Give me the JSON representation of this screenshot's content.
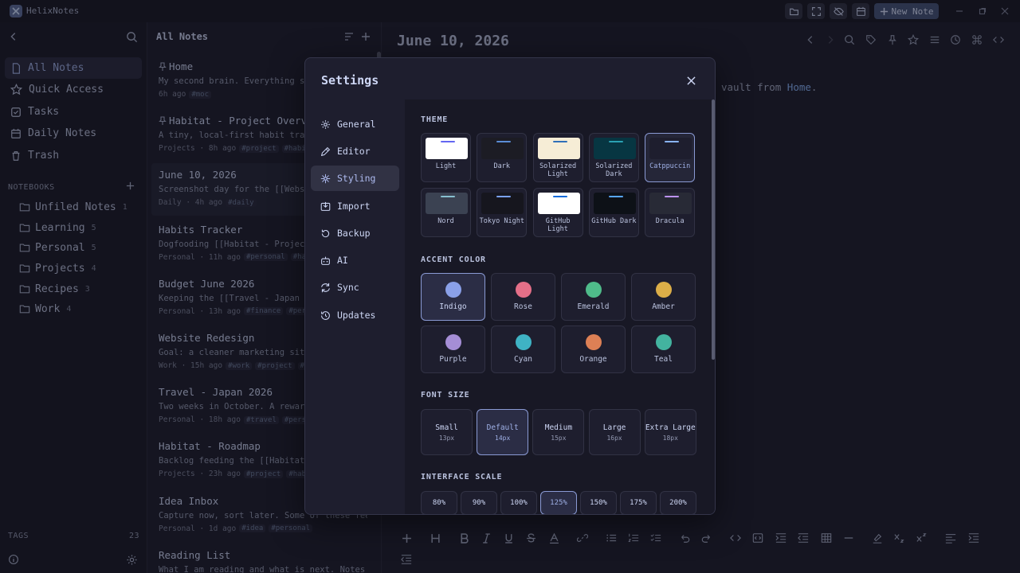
{
  "app": {
    "title": "HelixNotes",
    "new_note_label": "New Note"
  },
  "sidebar": {
    "nav": [
      {
        "label": "All Notes",
        "icon": "file-icon"
      },
      {
        "label": "Quick Access",
        "icon": "star-icon"
      },
      {
        "label": "Tasks",
        "icon": "checkbox-icon"
      },
      {
        "label": "Daily Notes",
        "icon": "calendar-icon"
      },
      {
        "label": "Trash",
        "icon": "trash-icon"
      }
    ],
    "notebooks_label": "NOTEBOOKS",
    "notebooks": [
      {
        "label": "Unfiled Notes",
        "count": "1"
      },
      {
        "label": "Learning",
        "count": "5"
      },
      {
        "label": "Personal",
        "count": "5"
      },
      {
        "label": "Projects",
        "count": "4"
      },
      {
        "label": "Recipes",
        "count": "3"
      },
      {
        "label": "Work",
        "count": "4"
      }
    ],
    "tags_label": "TAGS",
    "tags_count": "23"
  },
  "notes_list": {
    "header": "All Notes",
    "notes": [
      {
        "title": "Home",
        "pinned": true,
        "snippet": "My second brain. Everything sta",
        "meta": "6h ago",
        "tags": [
          "#moc"
        ]
      },
      {
        "title": "Habitat - Project Overvi",
        "pinned": true,
        "snippet": "A tiny, local-first habit track",
        "meta": "Projects · 8h ago",
        "tags": [
          "#project",
          "#habi"
        ]
      },
      {
        "title": "June 10, 2026",
        "pinned": false,
        "snippet": "Screenshot day for the [[Websit",
        "meta": "Daily · 4h ago",
        "tags": [
          "#daily"
        ]
      },
      {
        "title": "Habits Tracker",
        "pinned": false,
        "snippet": "Dogfooding [[Habitat - Project",
        "meta": "Personal · 11h ago",
        "tags": [
          "#personal",
          "#ha"
        ]
      },
      {
        "title": "Budget June 2026",
        "pinned": false,
        "snippet": "Keeping the [[Travel - Japan 20",
        "meta": "Personal · 13h ago",
        "tags": [
          "#finance",
          "#per"
        ]
      },
      {
        "title": "Website Redesign",
        "pinned": false,
        "snippet": "Goal: a cleaner marketing site",
        "meta": "Work · 15h ago",
        "tags": [
          "#work",
          "#project",
          "#"
        ]
      },
      {
        "title": "Travel - Japan 2026",
        "pinned": false,
        "snippet": "Two weeks in October. A reward",
        "meta": "Personal · 18h ago",
        "tags": [
          "#travel",
          "#pers"
        ]
      },
      {
        "title": "Habitat - Roadmap",
        "pinned": false,
        "snippet": "Backlog feeding the [[Habitat -",
        "meta": "Projects · 23h ago",
        "tags": [
          "#project",
          "#hab"
        ]
      },
      {
        "title": "Idea Inbox",
        "pinned": false,
        "snippet": "Capture now, sort later. Some of these feed",
        "meta": "Personal · 1d ago",
        "tags": [
          "#idea",
          "#personal"
        ]
      },
      {
        "title": "Reading List",
        "pinned": false,
        "snippet": "What I am reading and what is next. Notes _",
        "meta": "",
        "tags": []
      }
    ]
  },
  "editor": {
    "title": "June 10, 2026",
    "body_prefix": "vault from ",
    "body_link": "Home",
    "body_suffix": "."
  },
  "settings": {
    "title": "Settings",
    "nav": [
      {
        "label": "General",
        "icon": "gear-icon"
      },
      {
        "label": "Editor",
        "icon": "pencil-icon"
      },
      {
        "label": "Styling",
        "icon": "sparkle-icon"
      },
      {
        "label": "Import",
        "icon": "import-icon"
      },
      {
        "label": "Backup",
        "icon": "backup-icon"
      },
      {
        "label": "AI",
        "icon": "robot-icon"
      },
      {
        "label": "Sync",
        "icon": "sync-icon"
      },
      {
        "label": "Updates",
        "icon": "history-icon"
      }
    ],
    "theme_label": "THEME",
    "themes": [
      {
        "name": "Light",
        "bg": "#ffffff",
        "bar": "#6366f1"
      },
      {
        "name": "Dark",
        "bg": "#1c1c24",
        "bar": "#5b8dd6"
      },
      {
        "name": "Solarized Light",
        "bg": "#f6edd6",
        "bar": "#2f6fb8"
      },
      {
        "name": "Solarized Dark",
        "bg": "#073642",
        "bar": "#2aa1b3"
      },
      {
        "name": "Catppuccin",
        "bg": "#1e1e2e",
        "bar": "#89b4fa"
      },
      {
        "name": "Nord",
        "bg": "#3b4252",
        "bar": "#88c0d0"
      },
      {
        "name": "Tokyo Night",
        "bg": "#16161e",
        "bar": "#7aa2f7"
      },
      {
        "name": "GitHub Light",
        "bg": "#ffffff",
        "bar": "#0969da"
      },
      {
        "name": "GitHub Dark",
        "bg": "#0d1117",
        "bar": "#58a6ff"
      },
      {
        "name": "Dracula",
        "bg": "#282a36",
        "bar": "#bd93f9"
      }
    ],
    "accent_label": "ACCENT COLOR",
    "accents": [
      {
        "name": "Indigo",
        "color": "#8aa0e8"
      },
      {
        "name": "Rose",
        "color": "#e46f88"
      },
      {
        "name": "Emerald",
        "color": "#4fbb8a"
      },
      {
        "name": "Amber",
        "color": "#dcae48"
      },
      {
        "name": "Purple",
        "color": "#a58ed6"
      },
      {
        "name": "Cyan",
        "color": "#3fb3c4"
      },
      {
        "name": "Orange",
        "color": "#dd8055"
      },
      {
        "name": "Teal",
        "color": "#43b39f"
      }
    ],
    "font_size_label": "FONT SIZE",
    "font_sizes": [
      {
        "label": "Small",
        "sub": "13px"
      },
      {
        "label": "Default",
        "sub": "14px"
      },
      {
        "label": "Medium",
        "sub": "15px"
      },
      {
        "label": "Large",
        "sub": "16px"
      },
      {
        "label": "Extra Large",
        "sub": "18px"
      }
    ],
    "scale_label": "INTERFACE SCALE",
    "scales": [
      "80%",
      "90%",
      "100%",
      "125%",
      "150%",
      "175%",
      "200%"
    ]
  },
  "colors": {
    "accent": "#8a9ad4",
    "background": "#1e1e2e",
    "panel": "#181825"
  }
}
